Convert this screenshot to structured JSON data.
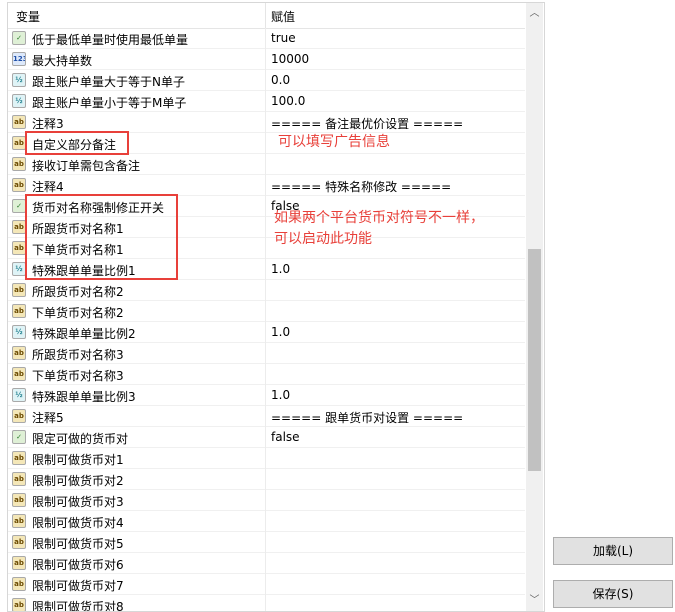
{
  "header": {
    "col_name": "变量",
    "col_value": "赋值"
  },
  "rows": [
    {
      "icon": "bool",
      "name": "低于最低单量时使用最低单量",
      "value": "true"
    },
    {
      "icon": "int",
      "name": "最大持单数",
      "value": "10000"
    },
    {
      "icon": "dbl",
      "name": "跟主账户单量大于等于N单子",
      "value": "0.0"
    },
    {
      "icon": "dbl",
      "name": "跟主账户单量小于等于M单子",
      "value": "100.0"
    },
    {
      "icon": "ab",
      "name": "注释3",
      "value": "===== 备注最优价设置 ====="
    },
    {
      "icon": "ab",
      "name": "自定义部分备注",
      "value": ""
    },
    {
      "icon": "ab",
      "name": "接收订单需包含备注",
      "value": ""
    },
    {
      "icon": "ab",
      "name": "注释4",
      "value": "===== 特殊名称修改 ====="
    },
    {
      "icon": "bool",
      "name": "货币对名称强制修正开关",
      "value": "false"
    },
    {
      "icon": "ab",
      "name": "所跟货币对名称1",
      "value": ""
    },
    {
      "icon": "ab",
      "name": "下单货币对名称1",
      "value": ""
    },
    {
      "icon": "dbl",
      "name": "特殊跟单单量比例1",
      "value": "1.0"
    },
    {
      "icon": "ab",
      "name": "所跟货币对名称2",
      "value": ""
    },
    {
      "icon": "ab",
      "name": "下单货币对名称2",
      "value": ""
    },
    {
      "icon": "dbl",
      "name": "特殊跟单单量比例2",
      "value": "1.0"
    },
    {
      "icon": "ab",
      "name": "所跟货币对名称3",
      "value": ""
    },
    {
      "icon": "ab",
      "name": "下单货币对名称3",
      "value": ""
    },
    {
      "icon": "dbl",
      "name": "特殊跟单单量比例3",
      "value": "1.0"
    },
    {
      "icon": "ab",
      "name": "注释5",
      "value": "===== 跟单货币对设置 ====="
    },
    {
      "icon": "bool",
      "name": "限定可做的货币对",
      "value": "false"
    },
    {
      "icon": "ab",
      "name": "限制可做货币对1",
      "value": ""
    },
    {
      "icon": "ab",
      "name": "限制可做货币对2",
      "value": ""
    },
    {
      "icon": "ab",
      "name": "限制可做货币对3",
      "value": ""
    },
    {
      "icon": "ab",
      "name": "限制可做货币对4",
      "value": ""
    },
    {
      "icon": "ab",
      "name": "限制可做货币对5",
      "value": ""
    },
    {
      "icon": "ab",
      "name": "限制可做货币对6",
      "value": ""
    },
    {
      "icon": "ab",
      "name": "限制可做货币对7",
      "value": ""
    },
    {
      "icon": "ab",
      "name": "限制可做货币对8",
      "value": ""
    }
  ],
  "icon_glyphs": {
    "ab": "ab",
    "bool": "✓",
    "int": "123",
    "dbl": "½"
  },
  "annotations": {
    "note1": "可以填写广告信息",
    "note2_line1": "如果两个平台货币对符号不一样，",
    "note2_line2": "可以启动此功能",
    "color": "#e8403a"
  },
  "buttons": {
    "load": "加载(L)",
    "save": "保存(S)"
  }
}
